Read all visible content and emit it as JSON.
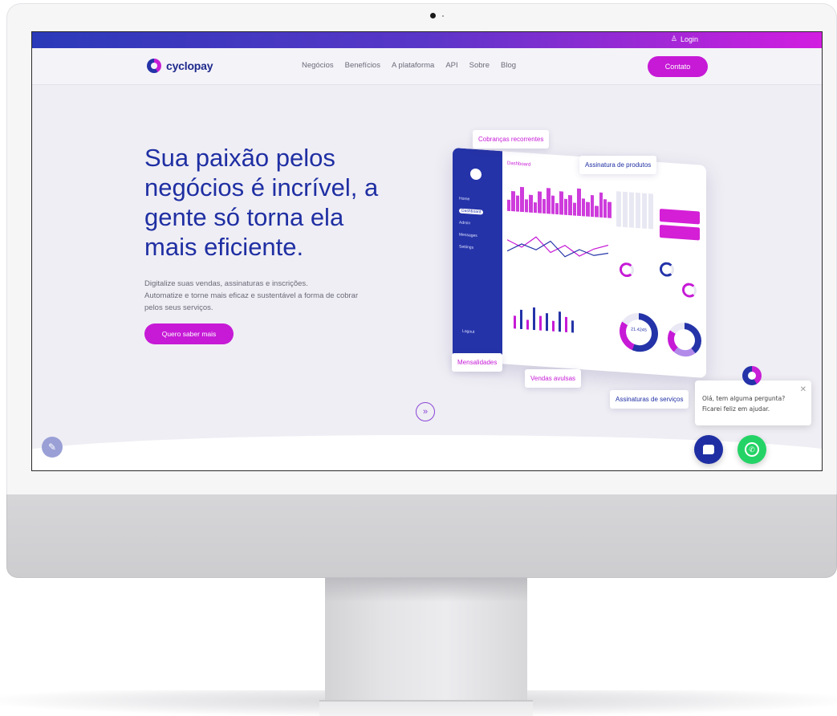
{
  "topbar": {
    "login_label": "Login",
    "login_icon": "user-icon"
  },
  "nav": {
    "logo_text": "cyclopay",
    "links": [
      "Negócios",
      "Benefícios",
      "A plataforma",
      "API",
      "Sobre",
      "Blog"
    ],
    "cta_label": "Contato"
  },
  "hero": {
    "title_lines": [
      "Sua paixão pelos",
      "negócios é incrível, a",
      "gente só torna ela",
      "mais eficiente."
    ],
    "subtitle_lines": [
      "Digitalize suas vendas, assinaturas e inscrições.",
      "Automatize e torne mais eficaz e sustentável a forma de cobrar",
      "pelos seus serviços."
    ],
    "button_label": "Quero saber mais"
  },
  "dashboard": {
    "title": "Dashboard",
    "menu": [
      "Home",
      "Dashboard",
      "Admin",
      "Messages",
      "Settings"
    ],
    "logout": "Logout",
    "donut_value": "21.4245"
  },
  "tags": {
    "cobrancas": "Cobranças recorrentes",
    "assinatura_produtos": "Assinatura de produtos",
    "mensalidades": "Mensalidades",
    "vendas_avulsas": "Vendas avulsas",
    "assinaturas_servicos": "Assinaturas de serviços"
  },
  "chat": {
    "line1": "Olá, tem alguma pergunta?",
    "line2": "Ficarei feliz em ajudar.",
    "close_icon": "close-icon"
  },
  "colors": {
    "brand_blue": "#1f2fa3",
    "brand_pink": "#c61ad6",
    "whatsapp": "#24d366"
  }
}
